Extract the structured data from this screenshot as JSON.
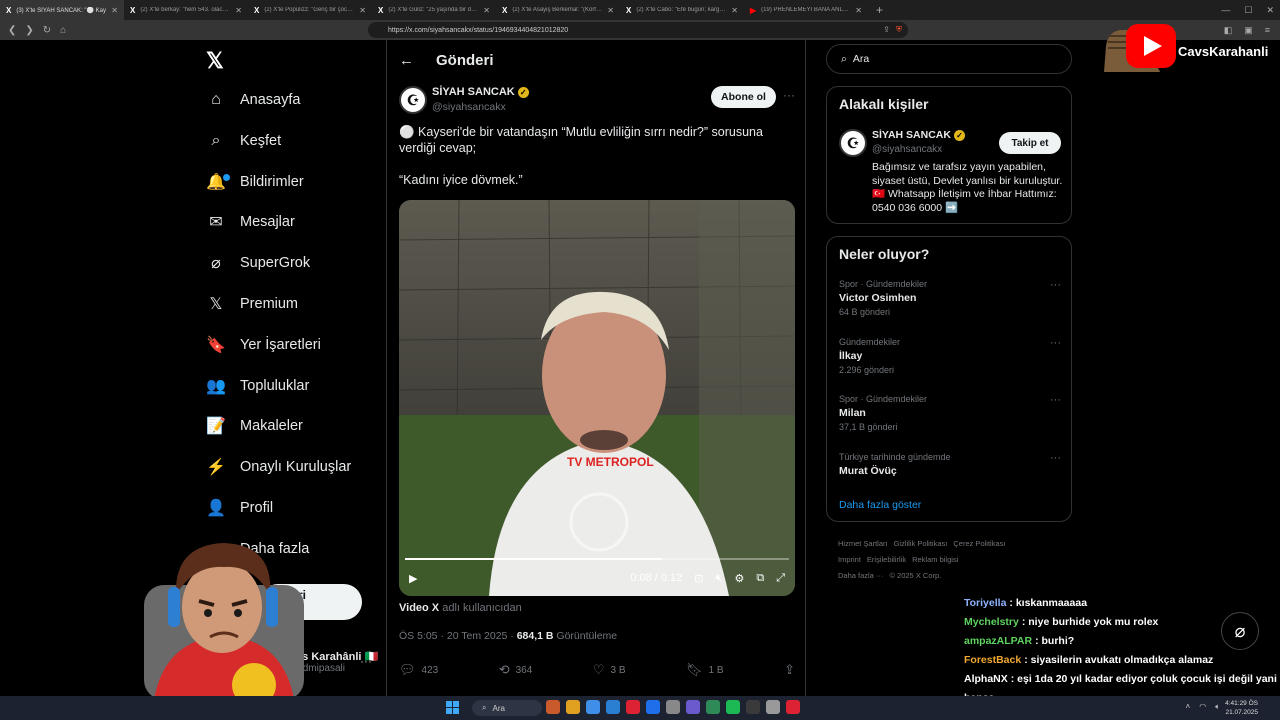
{
  "browser": {
    "tabs": [
      {
        "icon": "X",
        "title": "(3) X'te SİYAH SANCAK: \"⚪ Kay",
        "active": true
      },
      {
        "icon": "X",
        "title": "(2) X'te berkay: \"hem 543. olacak ko",
        "active": false
      },
      {
        "icon": "X",
        "title": "(2) X'te Popülizz: \"Genç bir çocuk, fu",
        "active": false
      },
      {
        "icon": "X",
        "title": "(2) X'te Güliz: \"25 yaşında bir doktor",
        "active": false
      },
      {
        "icon": "X",
        "title": "(2) X'te Asayiş Berkemal: \"(Körfez) b",
        "active": false
      },
      {
        "icon": "X",
        "title": "(2) X'te Cabo: \"Efe bugün; kargıdan k",
        "active": false
      },
      {
        "icon": "▶",
        "title": "(19) PRENLEMEYİ BANA ANLAT | 55",
        "active": false
      }
    ],
    "url": "https://x.com/siyahsancakx/status/1946934404821012820"
  },
  "sidebar": {
    "items": [
      {
        "label": "Anasayfa",
        "icon": "home-icon",
        "glyph": "⌂"
      },
      {
        "label": "Keşfet",
        "icon": "search-icon",
        "glyph": "⌕"
      },
      {
        "label": "Bildirimler",
        "icon": "bell-icon",
        "glyph": "🔔"
      },
      {
        "label": "Mesajlar",
        "icon": "mail-icon",
        "glyph": "✉"
      },
      {
        "label": "SuperGrok",
        "icon": "grok-icon",
        "glyph": "⌀"
      },
      {
        "label": "Premium",
        "icon": "x-premium-icon",
        "glyph": "𝕏"
      },
      {
        "label": "Yer İşaretleri",
        "icon": "bookmark-icon",
        "glyph": "🔖"
      },
      {
        "label": "Topluluklar",
        "icon": "communities-icon",
        "glyph": "👥"
      },
      {
        "label": "Makaleler",
        "icon": "article-icon",
        "glyph": "📝"
      },
      {
        "label": "Onaylı Kuruluşlar",
        "icon": "lightning-icon",
        "glyph": "⚡"
      },
      {
        "label": "Profil",
        "icon": "person-icon",
        "glyph": "👤"
      },
      {
        "label": "Daha fazla",
        "icon": "more-circle-icon",
        "glyph": "⋯"
      }
    ],
    "post_button": "Gönderi yayınla",
    "profile_name": "Cavs Karahânli 🇮🇹",
    "profile_handle": "@yadmipasali"
  },
  "post": {
    "header": "Gönderi",
    "author": "SİYAH SANCAK",
    "handle": "@siyahsancakx",
    "follow_label": "Abone ol",
    "text": "⚪ Kayseri'de bir vatandaşın “Mutlu evliliğin sırrı nedir?” sorusuna verdiği cevap;\n\n“Kadını iyice dövmek.”",
    "video": {
      "time": "0:08 / 0:12",
      "progress": 0.67,
      "watermark": "TV METROPOL"
    },
    "caption_from": "Video X",
    "caption_rest": " adlı kullanıcıdan",
    "time": "ÖS 5:05 · 20 Tem 2025 · ",
    "views": "684,1 B",
    "views_label": " Görüntüleme",
    "stats": {
      "replies": "423",
      "reposts": "364",
      "likes": "3 B",
      "bookmarks": "1 B"
    }
  },
  "right": {
    "search_placeholder": "Ara",
    "related_title": "Alakalı kişiler",
    "related": {
      "name": "SİYAH SANCAK",
      "handle": "@siyahsancakx",
      "follow": "Takip et",
      "bio": "Bağımsız ve tarafsız yayın yapabilen, siyaset üstü, Devlet yanlısı bir kuruluştur. 🇹🇷 Whatsapp İletişim ve İhbar Hattımız: 0540 036 6000 ➡️"
    },
    "trends_title": "Neler oluyor?",
    "trends": [
      {
        "category": "Spor · Gündemdekiler",
        "name": "Victor Osimhen",
        "count": "64 B gönderi"
      },
      {
        "category": "Gündemdekiler",
        "name": "İlkay",
        "count": "2.296 gönderi"
      },
      {
        "category": "Spor · Gündemdekiler",
        "name": "Milan",
        "count": "37,1 B gönderi"
      },
      {
        "category": "Türkiye tarihinde gündemde",
        "name": "Murat Övüç",
        "count": ""
      }
    ],
    "show_more": "Daha fazla göster",
    "footer": [
      "Hizmet Şartları",
      "Gizlilik Politikası",
      "Çerez Politikası",
      "Imprint",
      "Erişilebilirlik",
      "Reklam bilgisi",
      "Daha fazla ···",
      "© 2025 X Corp."
    ]
  },
  "stream": {
    "channel": "CavsKarahanli",
    "chat": [
      {
        "user": "Toriyella",
        "color": "#8fb4ff",
        "msg": ": kıskanmaaaaa"
      },
      {
        "user": "Mychelstry",
        "color": "#5fd35f",
        "msg": ": niye burhide yok mu rolex"
      },
      {
        "user": "ampazALPAR",
        "color": "#5fd35f",
        "msg": ": burhi?"
      },
      {
        "user": "ForestBack",
        "color": "#f0a830",
        "msg": ": siyasilerin avukatı olmadıkça alamaz"
      },
      {
        "user": "AlphaNX",
        "color": "#ffffff",
        "msg": ": eşi 1da 20 yıl kadar ediyor çoluk çocuk işi değil yani bence"
      }
    ]
  },
  "taskbar": {
    "search": "Ara",
    "time": "4:41:29 ÖS",
    "date": "21.07.2025"
  }
}
